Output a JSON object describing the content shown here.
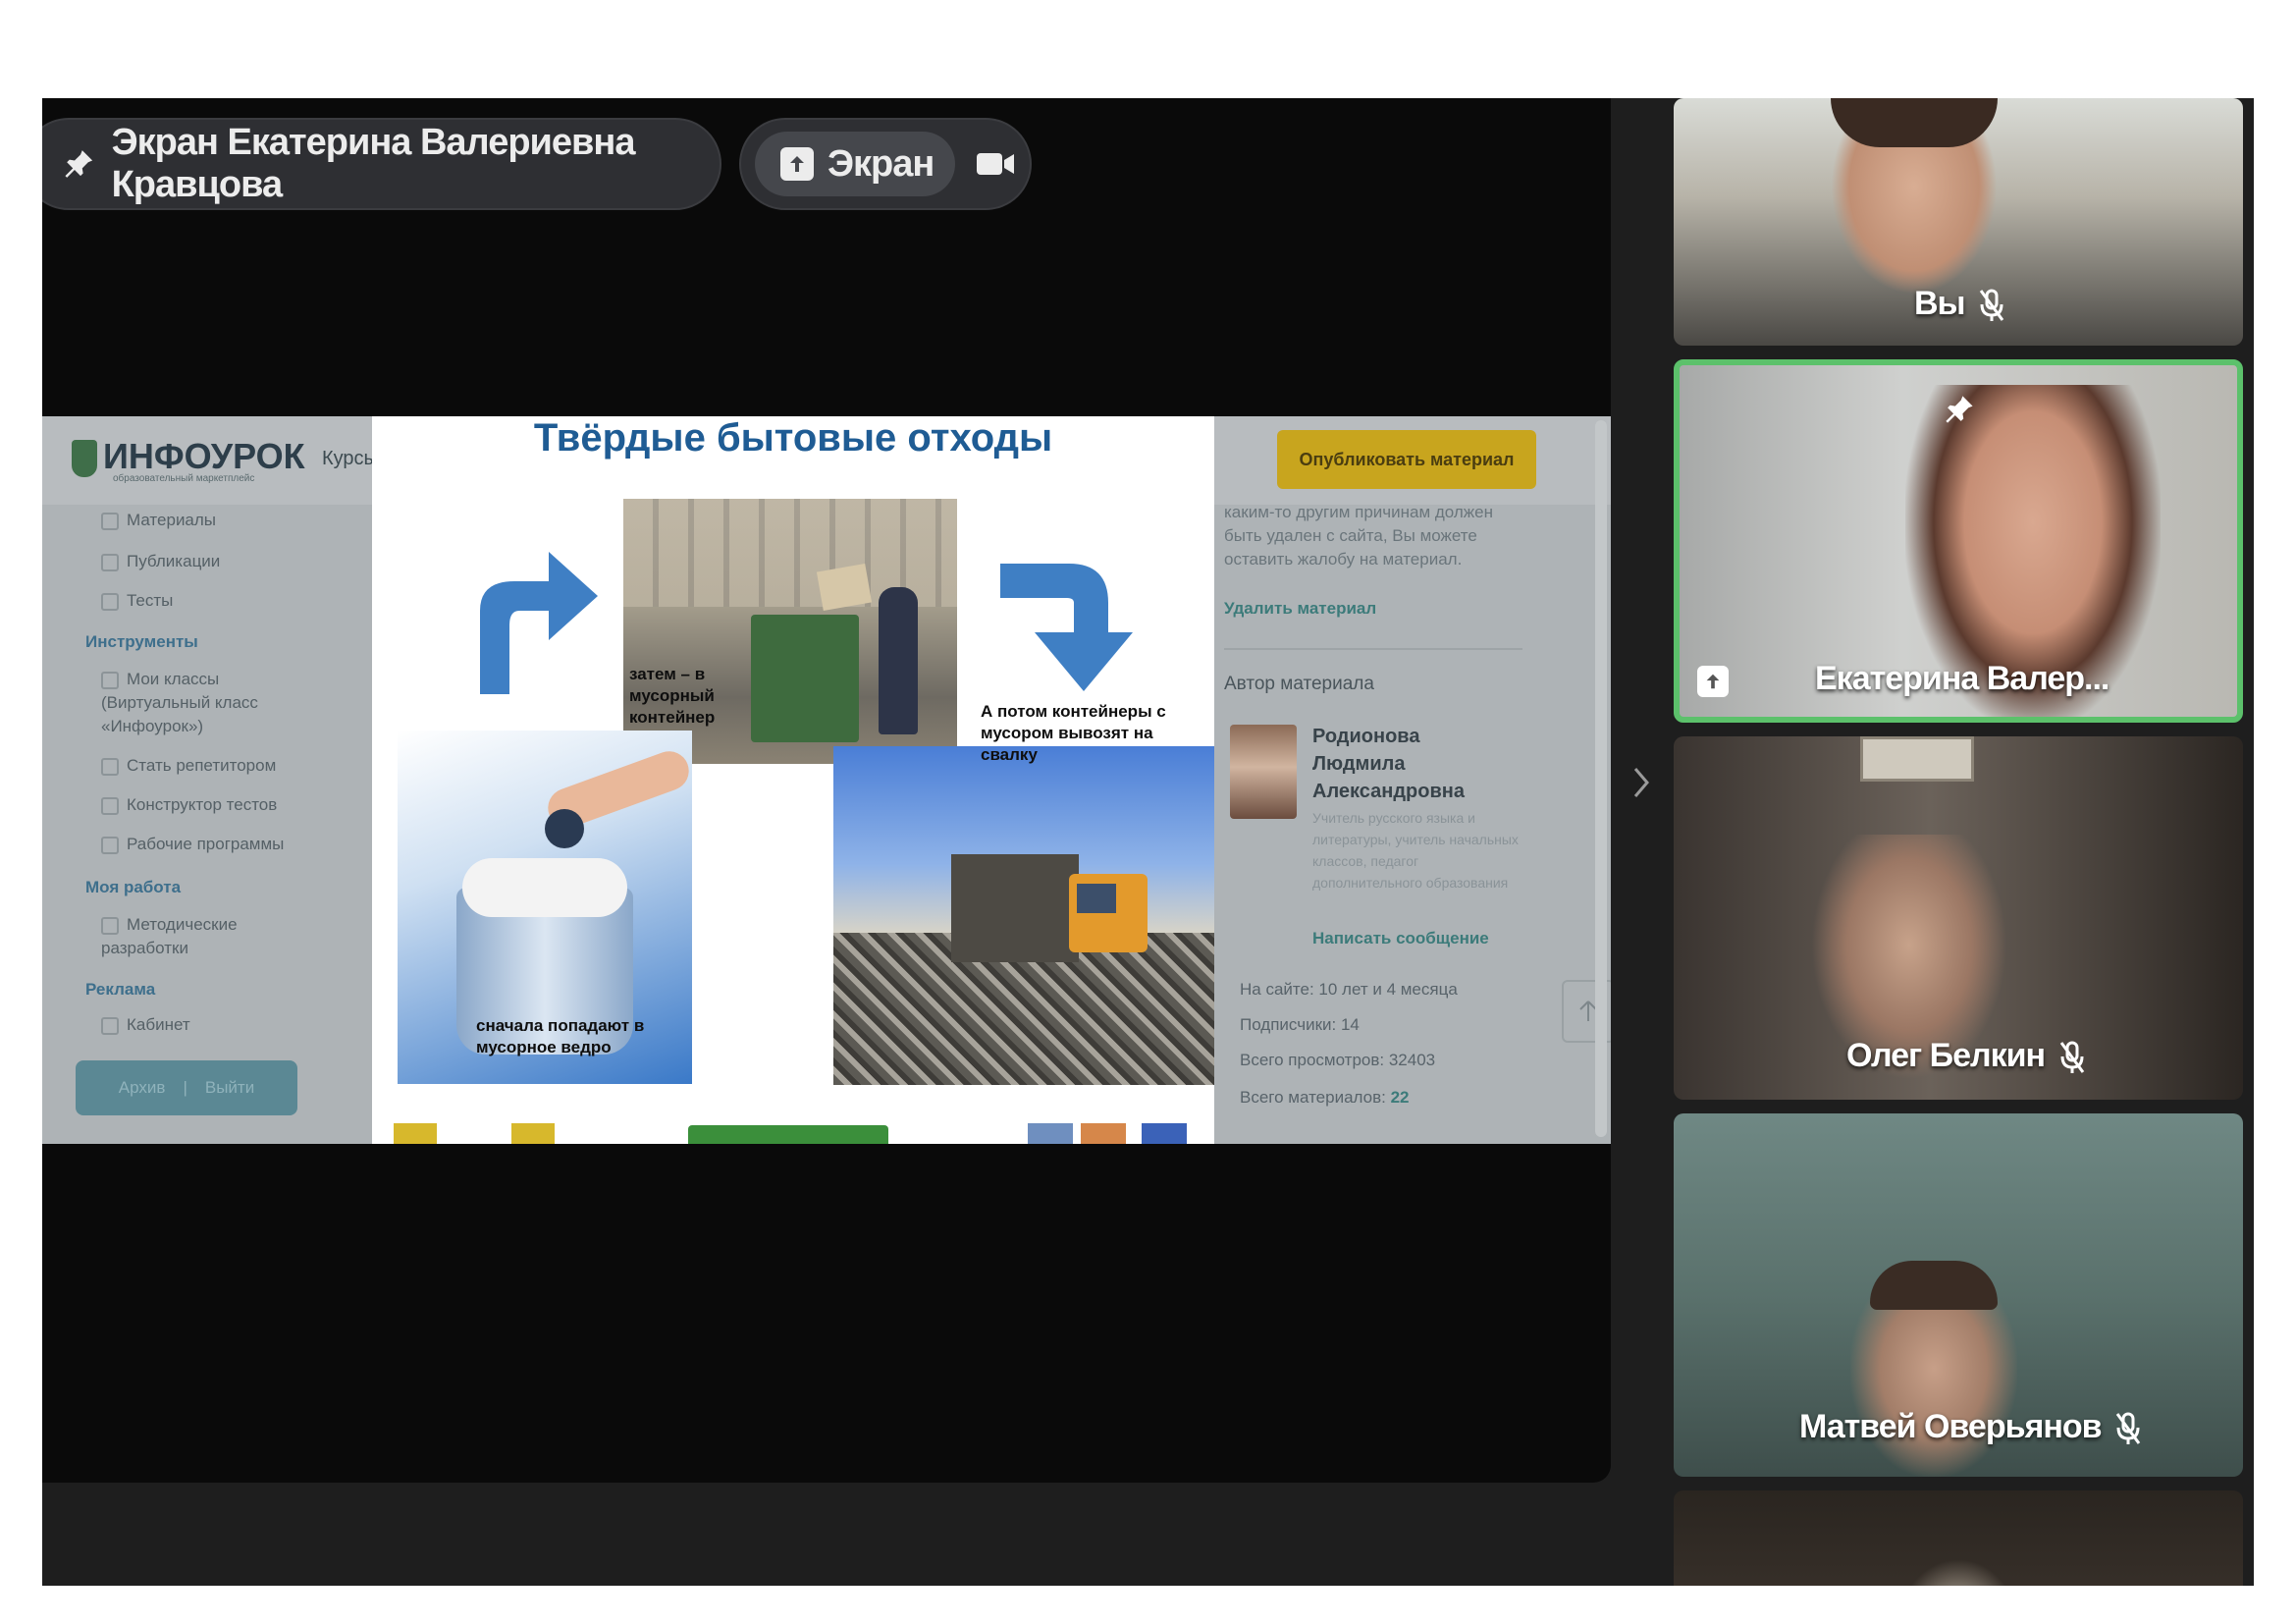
{
  "header": {
    "pinned_label": "Экран Екатерина Валериевна Кравцова",
    "screen_button_label": "Экран"
  },
  "shared_screen": {
    "site": {
      "logo": "ИНФОУРОК",
      "logo_subtitle": "образовательный маркетплейс",
      "nav_courses": "Курсы"
    },
    "sidebar": {
      "items_top": [
        "Материалы",
        "Публикации",
        "Тесты"
      ],
      "tools_heading": "Инструменты",
      "tools": [
        "Мои классы (Виртуальный класс «Инфоурок»)",
        "Стать репетитором",
        "Конструктор тестов",
        "Рабочие программы"
      ],
      "work_heading": "Моя работа",
      "work": [
        "Методические разработки"
      ],
      "ads_heading": "Реклама",
      "ads": [
        "Кабинет"
      ],
      "archive_label": "Архив",
      "exit_label": "Выйти"
    },
    "slide": {
      "title": "Твёрдые бытовые отходы",
      "caption_container": "затем – в мусорный контейнер",
      "caption_dump": "А потом контейнеры с мусором вывозят на свалку",
      "caption_bucket": "сначала попадают в мусорное ведро"
    },
    "right_panel": {
      "publish_button": "Опубликовать материал",
      "notice": "каким-то другим причинам должен быть удален с сайта, Вы можете оставить жалобу на материал.",
      "delete_link": "Удалить материал",
      "author_heading": "Автор материала",
      "author_name": "Родионова Людмила Александровна",
      "author_role": "Учитель русского языка и литературы, учитель начальных классов, педагог дополнительного образования",
      "message_link": "Написать сообщение",
      "on_site": "На сайте: 10 лет и 4 месяца",
      "subscribers": "Подписчики: 14",
      "views": "Всего просмотров: 32403",
      "materials_label": "Всего материалов:",
      "materials_count": "22"
    }
  },
  "participants": [
    {
      "name": "Вы",
      "muted": true
    },
    {
      "name": "Екатерина Валер...",
      "pinned": true,
      "presenting": true
    },
    {
      "name": "Олег Белкин",
      "muted": true
    },
    {
      "name": "Матвей Оверьянов",
      "muted": true
    }
  ],
  "colors": {
    "active_speaker_border": "#5cc16b",
    "app_background": "#1e1e1e",
    "slide_title": "#1f5c94"
  },
  "icons": [
    "pin-icon",
    "present-screen-icon",
    "camera-icon",
    "mic-off-icon",
    "chevron-right-icon",
    "arrow-up-icon"
  ]
}
